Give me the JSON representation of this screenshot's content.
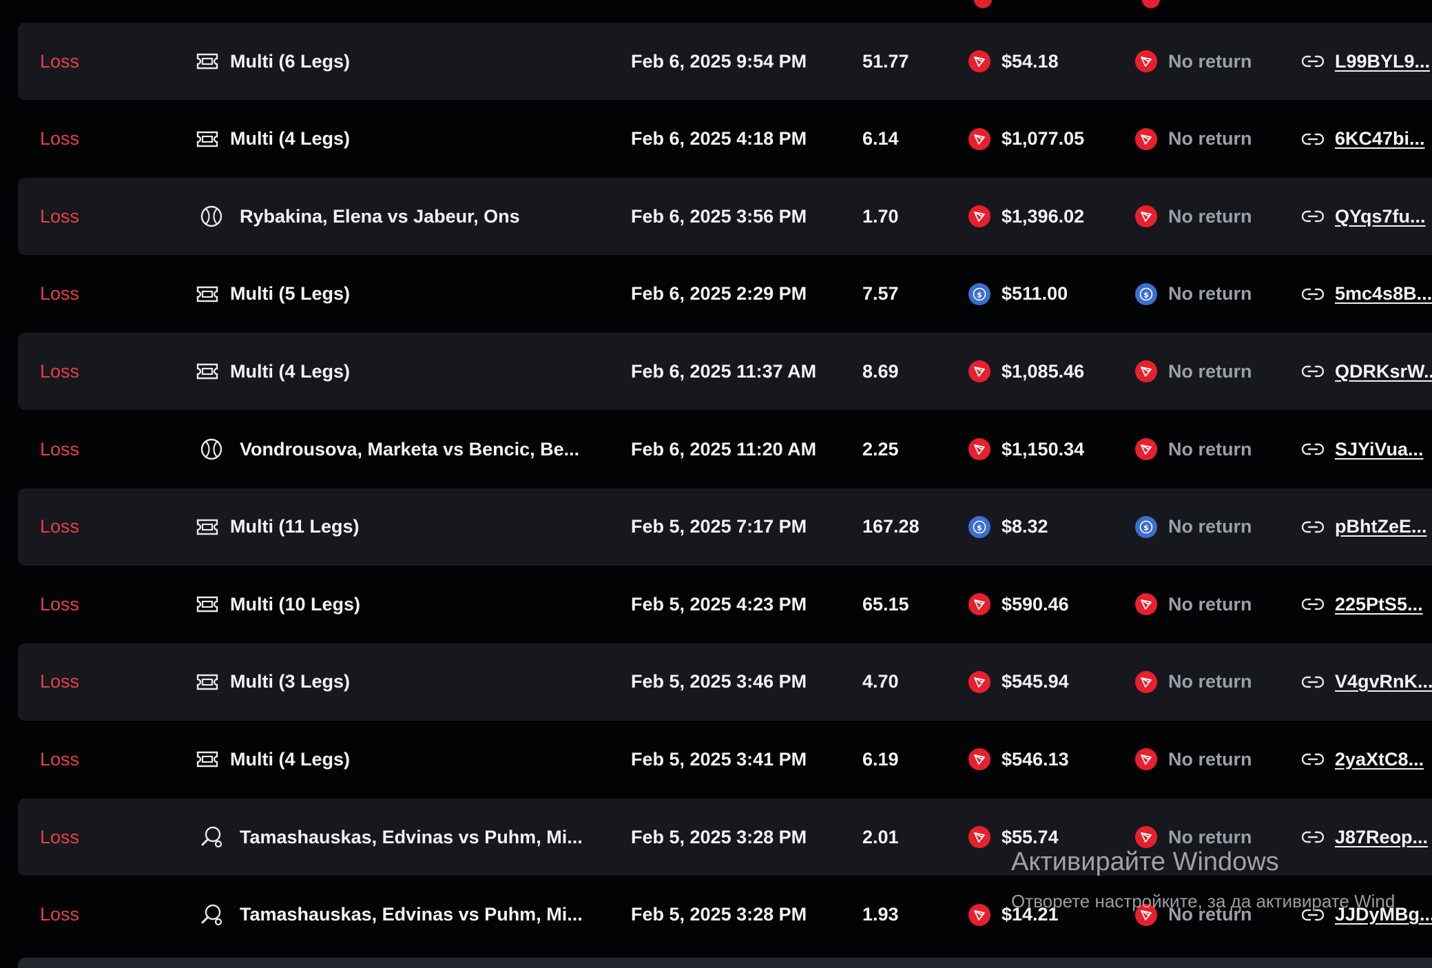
{
  "rows": [
    {
      "status": "Loss",
      "game": "Multi (6 Legs)",
      "game_icon": "ticket-icon",
      "date": "Feb 6, 2025 9:54 PM",
      "odds": "51.77",
      "coin": "tron",
      "stake": "$54.18",
      "payout": "No return",
      "hash": "L99BYL9..."
    },
    {
      "status": "Loss",
      "game": "Multi (4 Legs)",
      "game_icon": "ticket-icon",
      "date": "Feb 6, 2025 4:18 PM",
      "odds": "6.14",
      "coin": "tron",
      "stake": "$1,077.05",
      "payout": "No return",
      "hash": "6KC47bi..."
    },
    {
      "status": "Loss",
      "game": "Rybakina, Elena vs Jabeur, Ons",
      "game_icon": "tennis-ball-icon",
      "date": "Feb 6, 2025 3:56 PM",
      "odds": "1.70",
      "coin": "tron",
      "stake": "$1,396.02",
      "payout": "No return",
      "hash": "QYqs7fu..."
    },
    {
      "status": "Loss",
      "game": "Multi (5 Legs)",
      "game_icon": "ticket-icon",
      "date": "Feb 6, 2025 2:29 PM",
      "odds": "7.57",
      "coin": "usdc",
      "stake": "$511.00",
      "payout": "No return",
      "hash": "5mc4s8B..."
    },
    {
      "status": "Loss",
      "game": "Multi (4 Legs)",
      "game_icon": "ticket-icon",
      "date": "Feb 6, 2025 11:37 AM",
      "odds": "8.69",
      "coin": "tron",
      "stake": "$1,085.46",
      "payout": "No return",
      "hash": "QDRKsrW..."
    },
    {
      "status": "Loss",
      "game": "Vondrousova, Marketa vs Bencic, Be...",
      "game_icon": "tennis-ball-icon",
      "date": "Feb 6, 2025 11:20 AM",
      "odds": "2.25",
      "coin": "tron",
      "stake": "$1,150.34",
      "payout": "No return",
      "hash": "SJYiVua..."
    },
    {
      "status": "Loss",
      "game": "Multi (11 Legs)",
      "game_icon": "ticket-icon",
      "date": "Feb 5, 2025 7:17 PM",
      "odds": "167.28",
      "coin": "usdc",
      "stake": "$8.32",
      "payout": "No return",
      "hash": "pBhtZeE..."
    },
    {
      "status": "Loss",
      "game": "Multi (10 Legs)",
      "game_icon": "ticket-icon",
      "date": "Feb 5, 2025 4:23 PM",
      "odds": "65.15",
      "coin": "tron",
      "stake": "$590.46",
      "payout": "No return",
      "hash": "225PtS5..."
    },
    {
      "status": "Loss",
      "game": "Multi (3 Legs)",
      "game_icon": "ticket-icon",
      "date": "Feb 5, 2025 3:46 PM",
      "odds": "4.70",
      "coin": "tron",
      "stake": "$545.94",
      "payout": "No return",
      "hash": "V4gvRnK..."
    },
    {
      "status": "Loss",
      "game": "Multi (4 Legs)",
      "game_icon": "ticket-icon",
      "date": "Feb 5, 2025 3:41 PM",
      "odds": "6.19",
      "coin": "tron",
      "stake": "$546.13",
      "payout": "No return",
      "hash": "2yaXtC8..."
    },
    {
      "status": "Loss",
      "game": "Tamashauskas, Edvinas vs Puhm, Mi...",
      "game_icon": "table-tennis-icon",
      "date": "Feb 5, 2025 3:28 PM",
      "odds": "2.01",
      "coin": "tron",
      "stake": "$55.74",
      "payout": "No return",
      "hash": "J87Reop..."
    },
    {
      "status": "Loss",
      "game": "Tamashauskas, Edvinas vs Puhm, Mi...",
      "game_icon": "table-tennis-icon",
      "date": "Feb 5, 2025 3:28 PM",
      "odds": "1.93",
      "coin": "tron",
      "stake": "$14.21",
      "payout": "No return",
      "hash": "JJDyMBg..."
    }
  ],
  "colors": {
    "loss": "#e5404b",
    "row_alt": "#16181d",
    "tron": "#e8202d",
    "usdc": "#3b6fd1"
  },
  "watermark": {
    "title": "Активирайте Windows",
    "subtitle": "Отворете настройките, за да активирате Wind"
  }
}
